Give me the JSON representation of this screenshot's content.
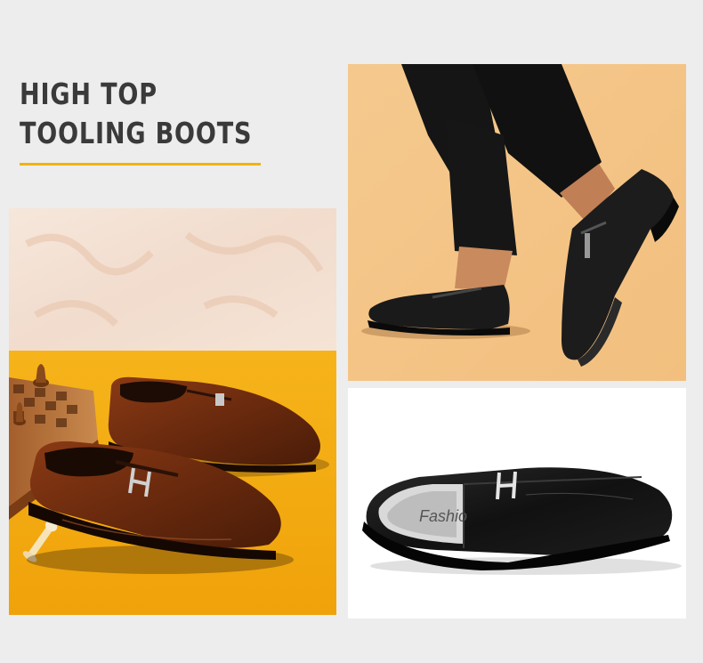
{
  "heading": {
    "line1": "HIGH TOP",
    "line2": "TOOLING BOOTS"
  },
  "colors": {
    "background": "#ededed",
    "accent": "#f0b400",
    "heading_text": "#3a3a3a"
  },
  "photos": {
    "insole_text": "Fashio"
  }
}
